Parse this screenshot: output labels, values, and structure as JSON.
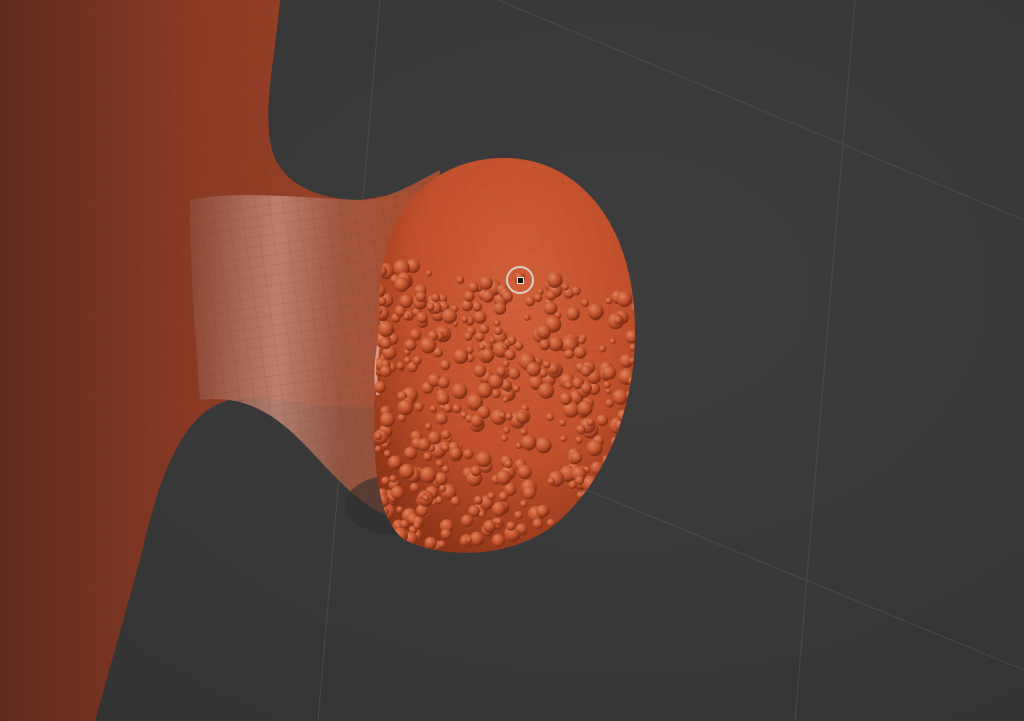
{
  "app": {
    "view": "3d-sculpt-viewport"
  },
  "viewport": {
    "background_color": "#383838",
    "grid_color": "#4a4a4a",
    "grid_visible": true
  },
  "mesh": {
    "base_color": "#c0502e",
    "shadow_color": "#7a2e18",
    "highlight_color": "#e8a890",
    "surface_detail": "bumpy-texture"
  },
  "cursor": {
    "icon": "brush-circle-icon"
  }
}
